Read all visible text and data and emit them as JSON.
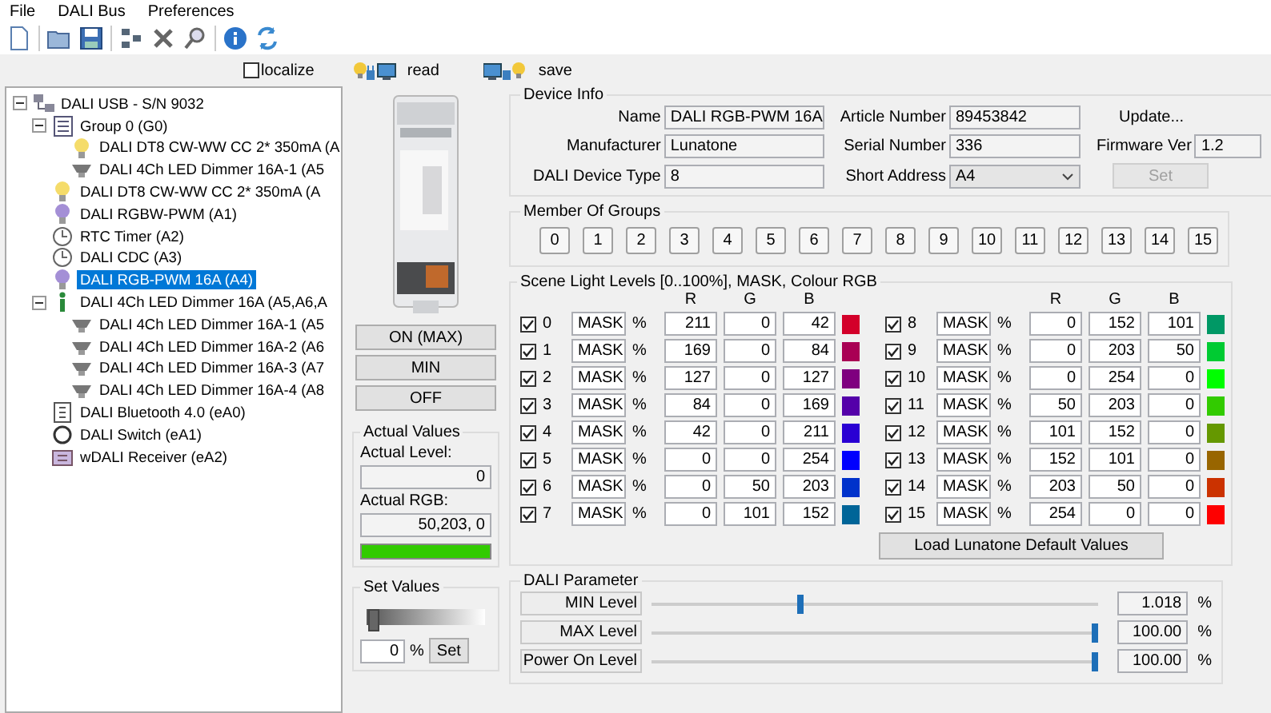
{
  "menu": [
    "File",
    "DALI Bus",
    "Preferences"
  ],
  "localize": {
    "label": "localize",
    "checked": false
  },
  "actions": [
    {
      "kind": "read",
      "label": "read"
    },
    {
      "kind": "save",
      "label": "save"
    }
  ],
  "tree": {
    "label": "DALI USB - S/N 9032",
    "kind": "bus",
    "expanded": true,
    "selected": false,
    "children": [
      {
        "label": "Group 0 (G0)",
        "kind": "group",
        "expanded": true,
        "selected": false,
        "children": [
          {
            "label": "DALI DT8 CW-WW CC 2* 350mA (A",
            "kind": "lamp",
            "selected": false
          },
          {
            "label": "DALI 4Ch LED Dimmer 16A-1 (A5",
            "kind": "spot",
            "selected": false
          }
        ]
      },
      {
        "label": "DALI DT8 CW-WW CC 2* 350mA (A",
        "kind": "lamp",
        "selected": false
      },
      {
        "label": "DALI RGBW-PWM (A1)",
        "kind": "rgblamp",
        "selected": false
      },
      {
        "label": "RTC Timer (A2)",
        "kind": "clock",
        "selected": false
      },
      {
        "label": "DALI CDC (A3)",
        "kind": "clock",
        "selected": false
      },
      {
        "label": "DALI RGB-PWM 16A (A4)",
        "kind": "rgblamp",
        "selected": true
      },
      {
        "label": "DALI 4Ch LED Dimmer 16A (A5,A6,A",
        "kind": "info",
        "expanded": true,
        "selected": false,
        "children": [
          {
            "label": "DALI 4Ch LED Dimmer 16A-1 (A5",
            "kind": "spot",
            "selected": false
          },
          {
            "label": "DALI 4Ch LED Dimmer 16A-2 (A6",
            "kind": "spot",
            "selected": false
          },
          {
            "label": "DALI 4Ch LED Dimmer 16A-3 (A7",
            "kind": "spot",
            "selected": false
          },
          {
            "label": "DALI 4Ch LED Dimmer 16A-4 (A8",
            "kind": "spot",
            "selected": false
          }
        ]
      },
      {
        "label": "DALI Bluetooth 4.0 (eA0)",
        "kind": "module",
        "selected": false
      },
      {
        "label": "DALI Switch (eA1)",
        "kind": "switch",
        "selected": false
      },
      {
        "label": "wDALI Receiver (eA2)",
        "kind": "receiver",
        "selected": false
      }
    ]
  },
  "device_buttons": [
    "ON (MAX)",
    "MIN",
    "OFF"
  ],
  "actual_values": {
    "title": "Actual Values",
    "level_label": "Actual Level:",
    "level_value": "0",
    "rgb_label": "Actual RGB:",
    "rgb_value": "50,203,  0",
    "color": "#32cb00"
  },
  "set_values": {
    "title": "Set Values",
    "level": 0.05,
    "value": "0",
    "unit": "%",
    "button": "Set"
  },
  "device_info": {
    "title": "Device Info",
    "rows": [
      [
        {
          "kind": "text",
          "label": "Name",
          "value": "DALI RGB-PWM 16A"
        },
        {
          "kind": "text",
          "label": "Article Number",
          "value": "89453842"
        },
        {
          "kind": "button",
          "label": "Update...",
          "disabled": false
        }
      ],
      [
        {
          "kind": "text",
          "label": "Manufacturer",
          "value": "Lunatone"
        },
        {
          "kind": "text",
          "label": "Serial Number",
          "value": "336"
        },
        {
          "kind": "text",
          "label": "Firmware Ver",
          "value": "1.2"
        }
      ],
      [
        {
          "kind": "text",
          "label": "DALI Device Type",
          "value": "8"
        },
        {
          "kind": "dropdown",
          "label": "Short Address",
          "value": "A4"
        },
        {
          "kind": "button",
          "label": "Set",
          "disabled": true
        }
      ]
    ]
  },
  "groups": {
    "title": "Member Of Groups",
    "items": [
      {
        "label": "0",
        "selected": false
      },
      {
        "label": "1",
        "selected": false
      },
      {
        "label": "2",
        "selected": false
      },
      {
        "label": "3",
        "selected": false
      },
      {
        "label": "4",
        "selected": false
      },
      {
        "label": "5",
        "selected": false
      },
      {
        "label": "6",
        "selected": false
      },
      {
        "label": "7",
        "selected": false
      },
      {
        "label": "8",
        "selected": false
      },
      {
        "label": "9",
        "selected": false
      },
      {
        "label": "10",
        "selected": false
      },
      {
        "label": "11",
        "selected": false
      },
      {
        "label": "12",
        "selected": false
      },
      {
        "label": "13",
        "selected": false
      },
      {
        "label": "14",
        "selected": false
      },
      {
        "label": "15",
        "selected": false
      }
    ]
  },
  "scenes": {
    "title": "Scene Light Levels [0..100%], MASK, Colour RGB",
    "columns": [
      "R",
      "G",
      "B",
      "R",
      "G",
      "B"
    ],
    "rows": [
      {
        "number": "0",
        "checked": true,
        "mask": "MASK",
        "unit": "%",
        "r": "211",
        "g": "0",
        "b": "42",
        "color": "#d3002a"
      },
      {
        "number": "1",
        "checked": true,
        "mask": "MASK",
        "unit": "%",
        "r": "169",
        "g": "0",
        "b": "84",
        "color": "#a90054"
      },
      {
        "number": "2",
        "checked": true,
        "mask": "MASK",
        "unit": "%",
        "r": "127",
        "g": "0",
        "b": "127",
        "color": "#7f007f"
      },
      {
        "number": "3",
        "checked": true,
        "mask": "MASK",
        "unit": "%",
        "r": "84",
        "g": "0",
        "b": "169",
        "color": "#5400a9"
      },
      {
        "number": "4",
        "checked": true,
        "mask": "MASK",
        "unit": "%",
        "r": "42",
        "g": "0",
        "b": "211",
        "color": "#2a00d3"
      },
      {
        "number": "5",
        "checked": true,
        "mask": "MASK",
        "unit": "%",
        "r": "0",
        "g": "0",
        "b": "254",
        "color": "#0000fe"
      },
      {
        "number": "6",
        "checked": true,
        "mask": "MASK",
        "unit": "%",
        "r": "0",
        "g": "50",
        "b": "203",
        "color": "#0032cb"
      },
      {
        "number": "7",
        "checked": true,
        "mask": "MASK",
        "unit": "%",
        "r": "0",
        "g": "101",
        "b": "152",
        "color": "#006598"
      },
      {
        "number": "8",
        "checked": true,
        "mask": "MASK",
        "unit": "%",
        "r": "0",
        "g": "152",
        "b": "101",
        "color": "#009865"
      },
      {
        "number": "9",
        "checked": true,
        "mask": "MASK",
        "unit": "%",
        "r": "0",
        "g": "203",
        "b": "50",
        "color": "#00cb32"
      },
      {
        "number": "10",
        "checked": true,
        "mask": "MASK",
        "unit": "%",
        "r": "0",
        "g": "254",
        "b": "0",
        "color": "#00fe00"
      },
      {
        "number": "11",
        "checked": true,
        "mask": "MASK",
        "unit": "%",
        "r": "50",
        "g": "203",
        "b": "0",
        "color": "#32cb00"
      },
      {
        "number": "12",
        "checked": true,
        "mask": "MASK",
        "unit": "%",
        "r": "101",
        "g": "152",
        "b": "0",
        "color": "#659800"
      },
      {
        "number": "13",
        "checked": true,
        "mask": "MASK",
        "unit": "%",
        "r": "152",
        "g": "101",
        "b": "0",
        "color": "#986500"
      },
      {
        "number": "14",
        "checked": true,
        "mask": "MASK",
        "unit": "%",
        "r": "203",
        "g": "50",
        "b": "0",
        "color": "#cb3200"
      },
      {
        "number": "15",
        "checked": true,
        "mask": "MASK",
        "unit": "%",
        "r": "254",
        "g": "0",
        "b": "0",
        "color": "#fe0000"
      }
    ],
    "button": "Load Lunatone Default Values"
  },
  "dali_parameter": {
    "title": "DALI Parameter",
    "rows": [
      {
        "label": "MIN Level",
        "level": 0.34,
        "value": "1.018",
        "unit": "%"
      },
      {
        "label": "MAX Level",
        "level": 1,
        "value": "100.00",
        "unit": "%"
      },
      {
        "label": "Power On Level",
        "level": 1,
        "value": "100.00",
        "unit": "%"
      }
    ]
  }
}
